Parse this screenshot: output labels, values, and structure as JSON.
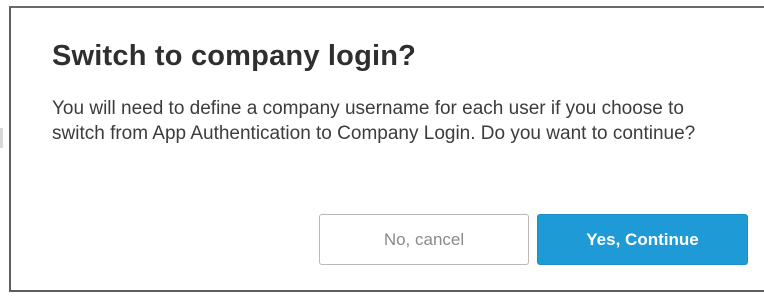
{
  "dialog": {
    "title": "Switch to company login?",
    "message": "You will need to define a company username for each user if you choose to switch from App Authentication to Company Login. Do you want to continue?",
    "cancel_label": "No, cancel",
    "confirm_label": "Yes, Continue"
  },
  "colors": {
    "primary_button": "#1e9bd7",
    "title_text": "#2f2f2f",
    "body_text": "#3c3c3c"
  }
}
